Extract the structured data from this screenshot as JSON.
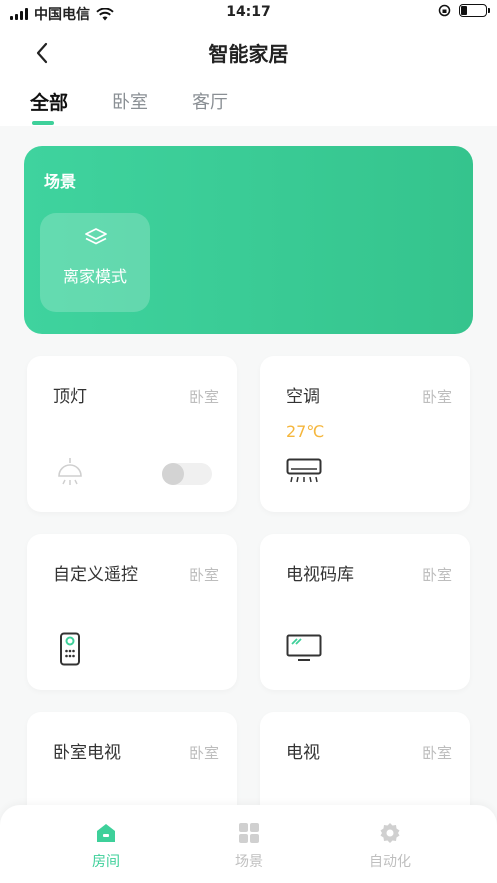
{
  "status_bar": {
    "carrier": "中国电信",
    "time": "14:17"
  },
  "header": {
    "title": "智能家居"
  },
  "tabs": [
    {
      "label": "全部"
    },
    {
      "label": "卧室"
    },
    {
      "label": "客厅"
    }
  ],
  "scene": {
    "title": "场景",
    "mode_label": "离家模式",
    "mode_icon": "layers-icon"
  },
  "devices": [
    {
      "name": "顶灯",
      "room": "卧室",
      "icon": "ceiling-lamp-icon",
      "switch_on": false
    },
    {
      "name": "空调",
      "room": "卧室",
      "temperature": "27℃",
      "icon": "air-conditioner-icon"
    },
    {
      "name": "自定义遥控",
      "room": "卧室",
      "icon": "remote-control-icon"
    },
    {
      "name": "电视码库",
      "room": "卧室",
      "icon": "tv-icon"
    },
    {
      "name": "卧室电视",
      "room": "卧室"
    },
    {
      "name": "电视",
      "room": "卧室"
    }
  ],
  "bottom_nav": [
    {
      "label": "房间",
      "icon": "house-icon",
      "active": true
    },
    {
      "label": "场景",
      "icon": "grid-icon",
      "active": false
    },
    {
      "label": "自动化",
      "icon": "automation-icon",
      "active": false
    }
  ],
  "colors": {
    "accent": "#3ed09a",
    "temperature": "#f5b63c"
  }
}
